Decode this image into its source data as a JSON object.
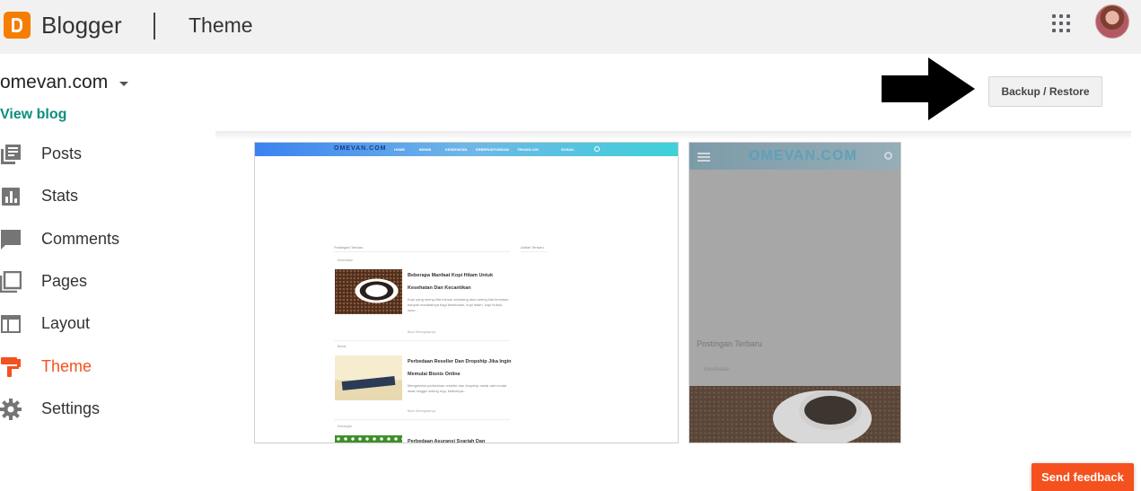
{
  "header": {
    "brand": "Blogger",
    "page_title": "Theme",
    "apps_icon": "apps-grid-icon",
    "avatar": "user-avatar"
  },
  "blog": {
    "name": "omevan.com",
    "view_blog": "View blog"
  },
  "actions": {
    "backup_restore": "Backup / Restore"
  },
  "sidebar": {
    "items": [
      {
        "label": "Posts",
        "icon": "posts-icon"
      },
      {
        "label": "Stats",
        "icon": "stats-icon"
      },
      {
        "label": "Comments",
        "icon": "comments-icon"
      },
      {
        "label": "Pages",
        "icon": "pages-icon"
      },
      {
        "label": "Layout",
        "icon": "layout-icon"
      },
      {
        "label": "Theme",
        "icon": "theme-icon",
        "active": true
      },
      {
        "label": "Settings",
        "icon": "settings-icon"
      }
    ]
  },
  "desktop_preview": {
    "site_logo": "OMEVAN.COM",
    "menu": [
      "HOME",
      "BISNIS",
      "KESEHATAN",
      "KEBERUNTUNGAN",
      "TEKNOLOGI",
      "SOSIAL"
    ],
    "section_left": "Postingan Terbaru",
    "section_right": "Artikel Terbaru",
    "posts": [
      {
        "label": "Kesehatan",
        "title": "Beberapa Manfaat Kopi Hitam Untuk Kesehatan Dan Kecantikan",
        "excerpt": "Kopi yang sering kita minum sekarang atau sering kita temukan banyak manfaatnya bagi kesehatan, kopi hitam, kopi bubuk, susu...",
        "read_more": "Baca Selengkapnya"
      },
      {
        "label": "Bisnis",
        "title": "Perbedaan Reseller Dan Dropship Jika Ingin Memulai Bisnis Online",
        "excerpt": "Mengetahui perbedaan reseller dan dropship mulai dari modal awal hingga untung rugi, keduanya...",
        "read_more": "Baca Selengkapnya"
      },
      {
        "label": "Keuangan",
        "title": "Perbedaan Asuransi Syariah Dan"
      }
    ]
  },
  "mobile_preview": {
    "site_logo": "OMEVAN.COM",
    "heading": "Postingan Terbaru",
    "sub": "Kesehatan"
  },
  "feedback": {
    "label": "Send feedback"
  },
  "colors": {
    "blogger_orange": "#f57d00",
    "accent": "#f4511e",
    "link": "#0a8f7c"
  }
}
